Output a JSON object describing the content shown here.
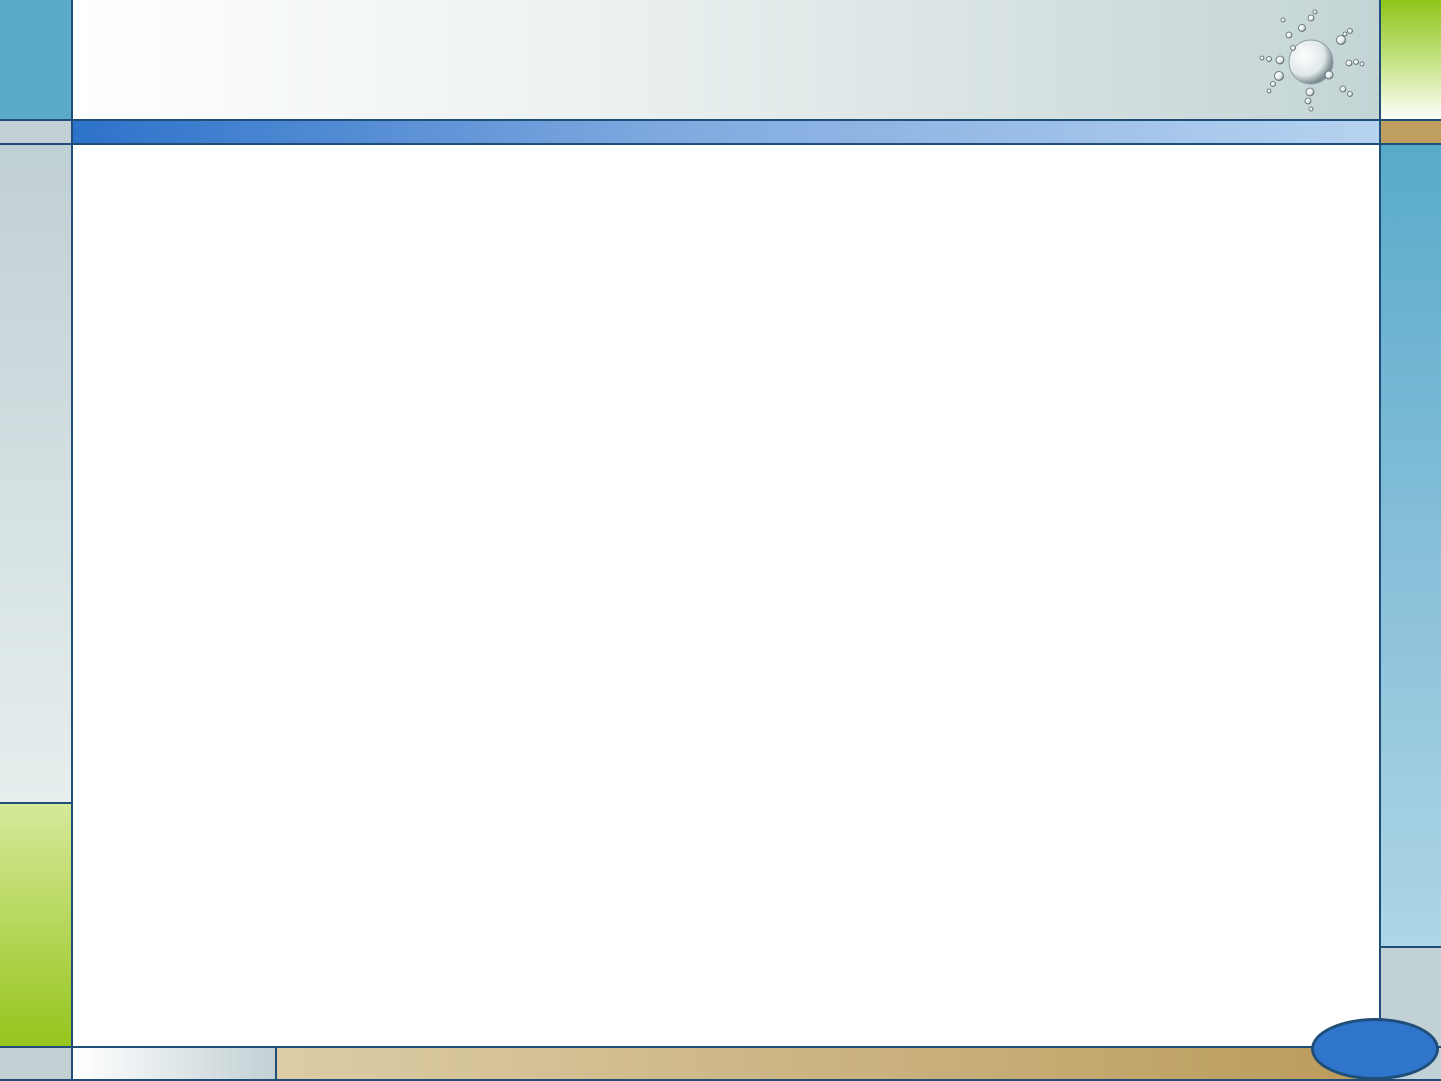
{
  "slide": {
    "colors": {
      "border_line": "#1f4e79",
      "teal_blue": "#5aaacc",
      "pale_blue_gray": "#c2d1d6",
      "lime_green": "#96c31a",
      "light_green": "#d3e88f",
      "tan": "#bf9f5f",
      "light_tan": "#dacba4",
      "accent_blue": "#2e75cb",
      "accent_blue_light": "#b4d2ef",
      "oval_fill": "#2e75cb"
    },
    "decoration": "sun-bubbles-icon"
  }
}
